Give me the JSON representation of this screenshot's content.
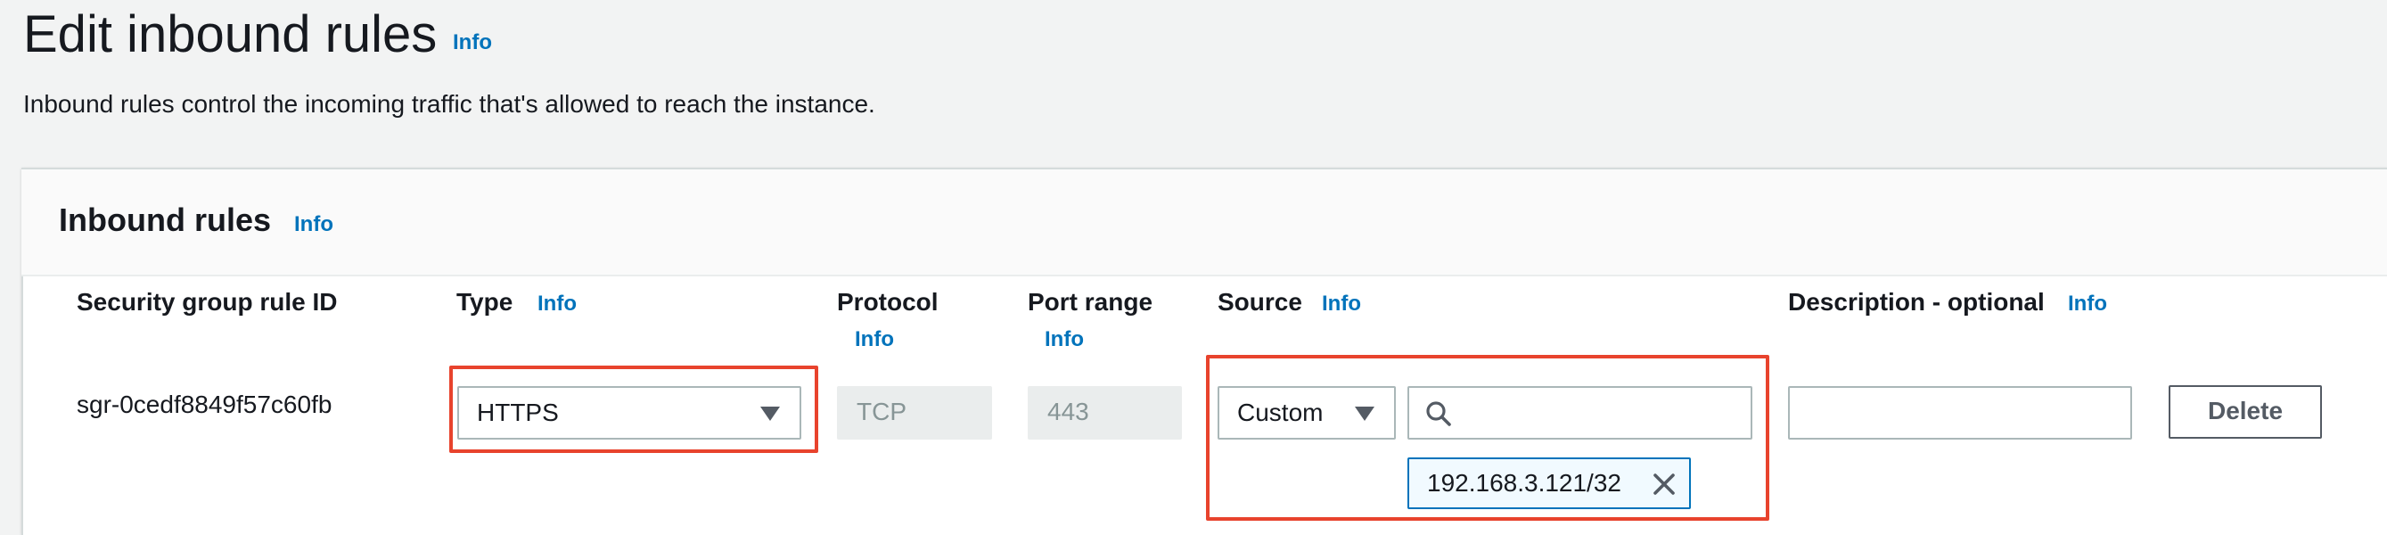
{
  "page": {
    "title": "Edit inbound rules",
    "title_info": "Info",
    "description": "Inbound rules control the incoming traffic that's allowed to reach the instance."
  },
  "panel": {
    "title": "Inbound rules",
    "title_info": "Info"
  },
  "columns": {
    "rule_id": "Security group rule ID",
    "type": "Type",
    "type_info": "Info",
    "protocol": "Protocol",
    "protocol_info": "Info",
    "port_range": "Port range",
    "port_range_info": "Info",
    "source": "Source",
    "source_info": "Info",
    "description": "Description - optional",
    "description_info": "Info"
  },
  "rule": {
    "id": "sgr-0cedf8849f57c60fb",
    "type_value": "HTTPS",
    "protocol_value": "TCP",
    "port_range_value": "443",
    "source_type_value": "Custom",
    "source_search_value": "",
    "source_token": "192.168.3.121/32",
    "description_value": "",
    "delete_label": "Delete"
  },
  "colors": {
    "info_link": "#0073bb",
    "highlight_border": "#e8432d",
    "token_border": "#0073bb",
    "token_bg": "#f1faff",
    "page_bg": "#f2f3f3"
  },
  "icons": {
    "type_dropdown": "caret-down-icon",
    "source_dropdown": "caret-down-icon",
    "search": "search-icon",
    "token_remove": "close-icon"
  }
}
